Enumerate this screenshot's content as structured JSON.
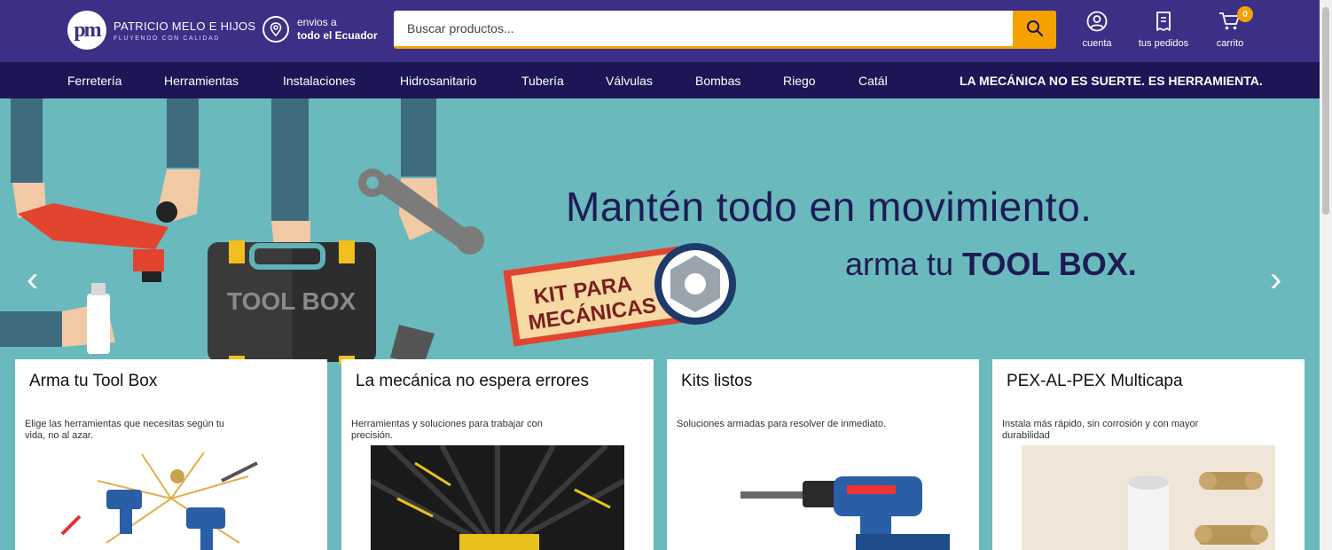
{
  "brand": {
    "logo_mark": "pm",
    "name": "PATRICIO MELO E HIJOS",
    "tagline": "FLUYENDO CON CALIDAD"
  },
  "shipping": {
    "line1": "envios a",
    "line2": "todo el Ecuador",
    "icon": "location-pin-icon"
  },
  "search": {
    "placeholder": "Buscar productos...",
    "icon": "search-icon"
  },
  "account": [
    {
      "label": "cuenta",
      "icon": "user-circle-icon"
    },
    {
      "label": "tus pedidos",
      "icon": "receipt-icon"
    },
    {
      "label": "carrito",
      "icon": "cart-icon",
      "badge": "0"
    }
  ],
  "nav": {
    "items": [
      "Ferretería",
      "Herramientas",
      "Instalaciones",
      "Hidrosanitario",
      "Tubería",
      "Válvulas",
      "Bombas",
      "Riego",
      "Catál"
    ],
    "slogan": "LA MECÁNICA NO ES SUERTE. ES HERRAMIENTA."
  },
  "hero": {
    "headline": "Mantén todo en movimiento.",
    "sub_prefix": "arma tu ",
    "sub_bold": "TOOL BOX.",
    "toolbox_label": "TOOL BOX",
    "kit_line1": "KIT PARA",
    "kit_line2": "MECÁNICAS",
    "prev_arrow": "‹",
    "next_arrow": "›"
  },
  "cards": [
    {
      "title": "Arma tu Tool Box",
      "desc": "Elige las herramientas que necesitas según tu vida, no al azar."
    },
    {
      "title": "La mecánica no espera errores",
      "desc": "Herramientas y soluciones para trabajar con precisión."
    },
    {
      "title": "Kits listos",
      "desc": "Soluciones armadas para resolver de inmediato."
    },
    {
      "title": "PEX-AL-PEX Multicapa",
      "desc": "Instala más rápido, sin corrosión y con mayor durabilidad"
    }
  ],
  "colors": {
    "header": "#3b2f86",
    "nav": "#1c1656",
    "accent": "#f5a100",
    "hero_bg": "#6ab9bd",
    "headline": "#1e1b55"
  }
}
